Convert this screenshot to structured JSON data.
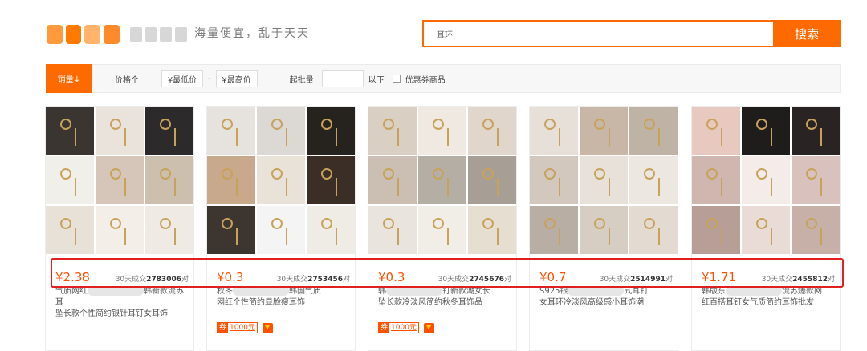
{
  "header": {
    "slogan": "海量便宜，乱于天天",
    "search_value": "耳环",
    "search_button": "搜索"
  },
  "filters": {
    "sort_sales": "销量↓",
    "sort_price": "价格个",
    "min_price": "¥最低价",
    "separator": "-",
    "max_price": "¥最高价",
    "moq_label": "起批量",
    "below": "以下",
    "coupon_label": "优惠券商品"
  },
  "products": [
    {
      "price": "¥2.38",
      "sales_prefix": "30天成交",
      "sales_count": "2783006",
      "sales_unit": "对",
      "title_line1": "气质网红",
      "title_line1b": "韩新款流苏耳",
      "title_line2": "坠长款个性简约银针耳钉女耳饰",
      "coupon": ""
    },
    {
      "price": "¥0.3",
      "sales_prefix": "30天成交",
      "sales_count": "2753456",
      "sales_unit": "对",
      "title_line1": "秋冬",
      "title_line1b": "韩国气质",
      "title_line2": "网红个性简约显脸瘦耳饰",
      "coupon": "1000元"
    },
    {
      "price": "¥0.3",
      "sales_prefix": "30天成交",
      "sales_count": "2745676",
      "sales_unit": "对",
      "title_line1": "韩",
      "title_line1b": "钉新款潮女长",
      "title_line2": "坠长款冷淡风简约秋冬耳饰品",
      "coupon": "1000元"
    },
    {
      "price": "¥0.7",
      "sales_prefix": "30天成交",
      "sales_count": "2514991",
      "sales_unit": "对",
      "title_line1": "S925银",
      "title_line1b": "式耳钉",
      "title_line2": "女耳环冷淡风高级感小耳饰潮",
      "coupon": ""
    },
    {
      "price": "¥1.71",
      "sales_prefix": "30天成交",
      "sales_count": "2455812",
      "sales_unit": "对",
      "title_line1": "韩版东",
      "title_line1b": "流苏爆款网",
      "title_line2": "红百搭耳钉女气质简约耳饰批发",
      "coupon": ""
    }
  ]
}
